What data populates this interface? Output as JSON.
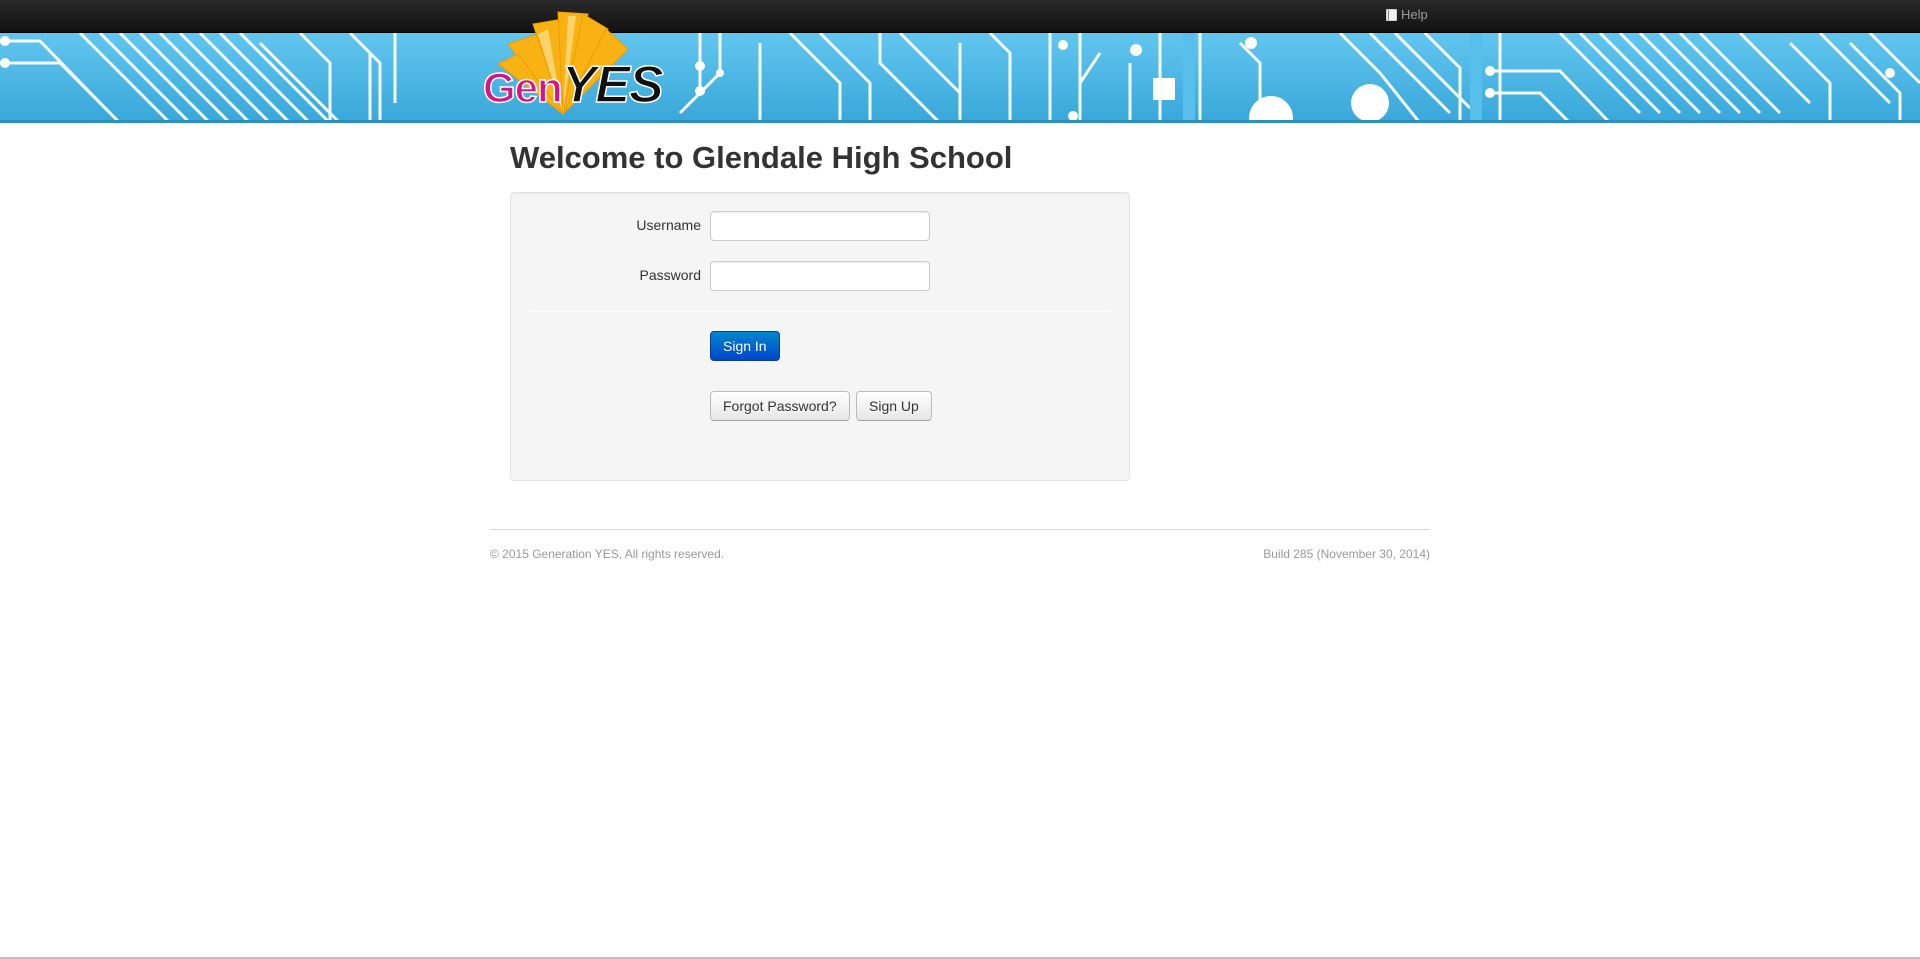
{
  "header": {
    "help_label": "Help",
    "help_icon": "book-icon"
  },
  "brand": {
    "logo_gen": "Gen",
    "logo_yes": "YES",
    "gen_color": "#d4148a",
    "burst_color": "#f8b214",
    "banner_color": "#4db8e8"
  },
  "page": {
    "title": "Welcome to Glendale High School"
  },
  "login": {
    "username_label": "Username",
    "username_value": "",
    "password_label": "Password",
    "password_value": "",
    "sign_in_label": "Sign In",
    "forgot_password_label": "Forgot Password?",
    "sign_up_label": "Sign Up"
  },
  "footer": {
    "copyright": "© 2015 Generation YES, All rights reserved.",
    "build": "Build 285 (November 30, 2014)"
  }
}
